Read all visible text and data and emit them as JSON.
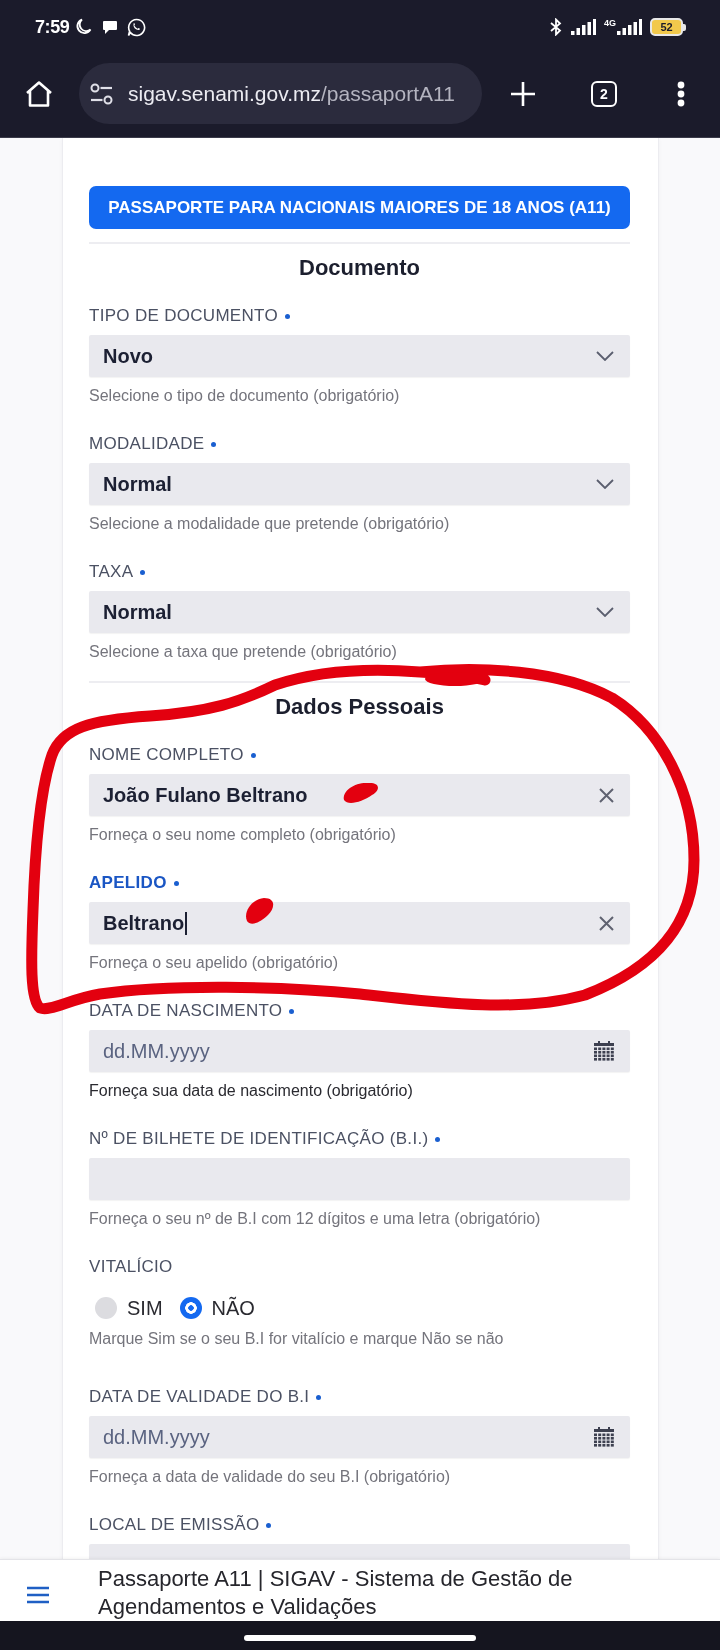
{
  "status_bar": {
    "time": "7:59",
    "network": "4G",
    "battery": "52"
  },
  "browser": {
    "url_host": "sigav.senami.gov.mz",
    "url_path": "/passaportA11",
    "tab_count": "2"
  },
  "banner": "PASSAPORTE PARA NACIONAIS MAIORES DE 18 ANOS (A11)",
  "sections": [
    {
      "title": "Documento",
      "fields": [
        {
          "kind": "select",
          "label": "TIPO DE DOCUMENTO",
          "required": true,
          "focused": false,
          "value": "Novo",
          "help": "Selecione o tipo de documento (obrigatório)",
          "help_emphasized": false
        },
        {
          "kind": "select",
          "label": "MODALIDADE",
          "required": true,
          "focused": false,
          "value": "Normal",
          "help": "Selecione a modalidade que pretende (obrigatório)",
          "help_emphasized": false
        },
        {
          "kind": "select",
          "label": "TAXA",
          "required": true,
          "focused": false,
          "value": "Normal",
          "help": "Selecione a taxa que pretende (obrigatório)",
          "help_emphasized": false
        }
      ]
    },
    {
      "title": "Dados Pessoais",
      "fields": [
        {
          "kind": "text",
          "label": "NOME COMPLETO",
          "required": true,
          "focused": false,
          "value": "João Fulano Beltrano",
          "help": "Forneça o seu nome completo (obrigatório)",
          "help_emphasized": false
        },
        {
          "kind": "text",
          "label": "APELIDO",
          "required": true,
          "focused": true,
          "value": "Beltrano",
          "help": "Forneça o seu apelido (obrigatório)",
          "help_emphasized": false
        },
        {
          "kind": "date",
          "label": "DATA DE NASCIMENTO",
          "required": true,
          "focused": false,
          "placeholder": "dd.MM.yyyy",
          "help": "Forneça sua data de nascimento (obrigatório)",
          "help_emphasized": true
        },
        {
          "kind": "text",
          "label": "Nº DE BILHETE DE IDENTIFICAÇÃO (B.I.)",
          "required": true,
          "focused": false,
          "help": "Forneça o seu nº de B.I com 12 dígitos e uma letra (obrigatório)",
          "help_emphasized": false
        },
        {
          "kind": "radio",
          "label": "VITALÍCIO",
          "required": false,
          "focused": false,
          "options": [
            {
              "label": "SIM",
              "selected": false
            },
            {
              "label": "NÃO",
              "selected": true
            }
          ],
          "help": "Marque Sim se o seu B.I for vitalício e marque Não se não",
          "help_emphasized": false
        },
        {
          "kind": "date",
          "label": "DATA DE VALIDADE DO B.I",
          "required": true,
          "focused": false,
          "placeholder": "dd.MM.yyyy",
          "help": "Forneça a data de validade do seu B.I (obrigatório)",
          "help_emphasized": false
        },
        {
          "kind": "text",
          "label": "LOCAL DE EMISSÃO",
          "required": true,
          "focused": false
        }
      ]
    }
  ],
  "bottom_bar": {
    "title": "Passaporte A11 | SIGAV - Sistema de Gestão de Agendamentos e Validações"
  }
}
